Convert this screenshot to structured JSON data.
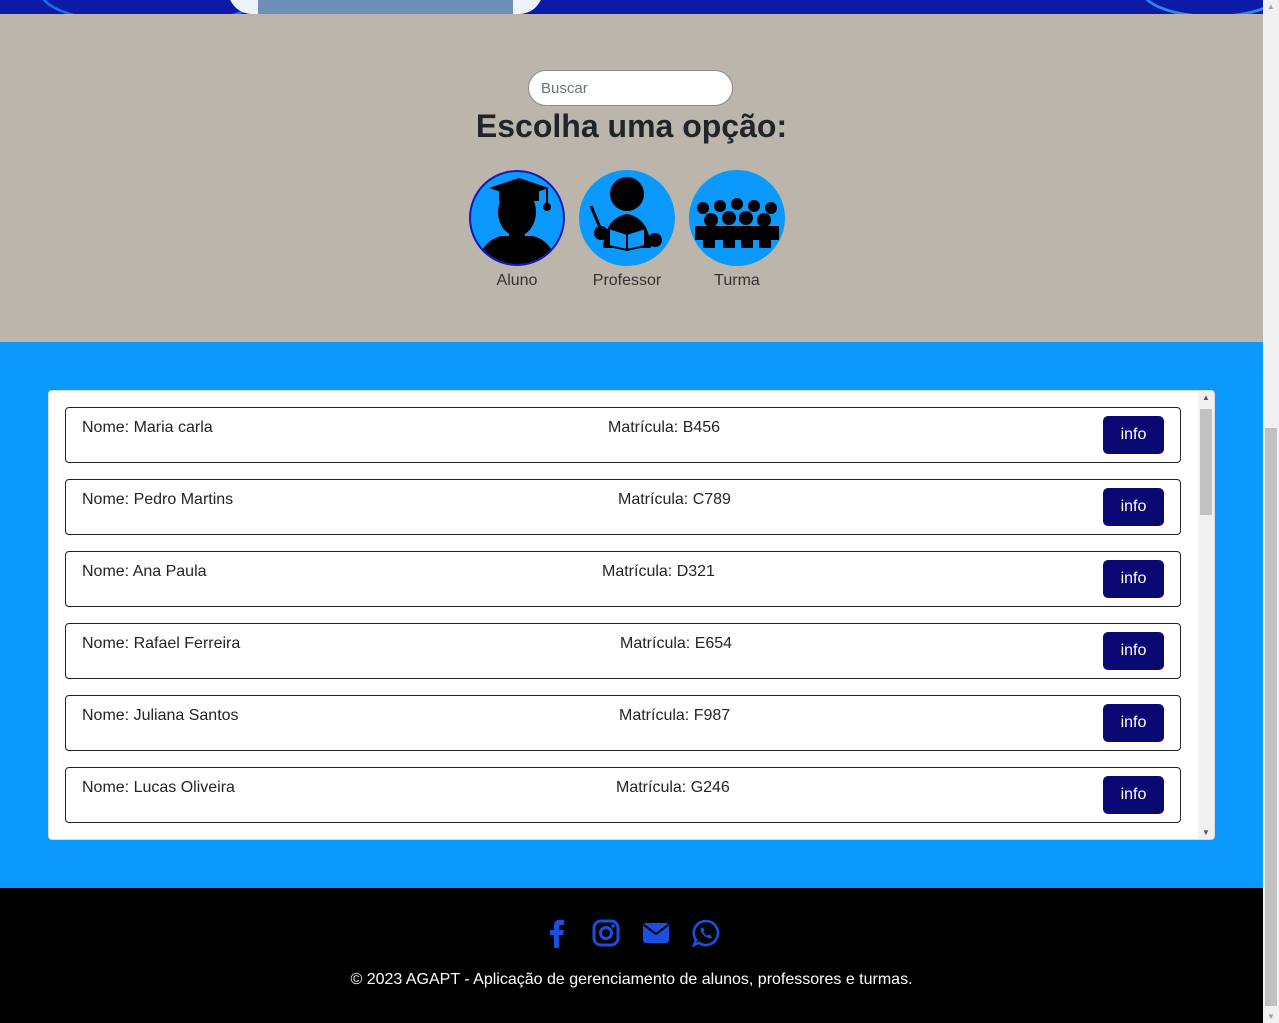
{
  "search": {
    "placeholder": "Buscar"
  },
  "heading": "Escolha uma opção:",
  "options": [
    {
      "label": "Aluno",
      "icon": "graduate-icon",
      "selected": true
    },
    {
      "label": "Professor",
      "icon": "teacher-icon",
      "selected": false
    },
    {
      "label": "Turma",
      "icon": "class-group-icon",
      "selected": false
    }
  ],
  "students": [
    {
      "nome": "Nome: Maria carla",
      "matricula": "Matrícula: B456",
      "button": "info"
    },
    {
      "nome": "Nome: Pedro Martins",
      "matricula": "Matrícula: C789",
      "button": "info"
    },
    {
      "nome": "Nome: Ana Paula",
      "matricula": "Matrícula: D321",
      "button": "info"
    },
    {
      "nome": "Nome: Rafael Ferreira",
      "matricula": "Matrícula: E654",
      "button": "info"
    },
    {
      "nome": "Nome: Juliana Santos",
      "matricula": "Matrícula: F987",
      "button": "info"
    },
    {
      "nome": "Nome: Lucas Oliveira",
      "matricula": "Matrícula: G246",
      "button": "info"
    }
  ],
  "footer": {
    "social": [
      "facebook-icon",
      "instagram-icon",
      "email-icon",
      "whatsapp-icon"
    ],
    "copyright": "© 2023 AGAPT - Aplicação de gerenciamento de alunos, professores e turmas."
  },
  "colors": {
    "accent_blue": "#0b99fe",
    "button_navy": "#0a0873",
    "social_blue": "#1a4fe0",
    "section_grey": "#bbb5ab"
  }
}
